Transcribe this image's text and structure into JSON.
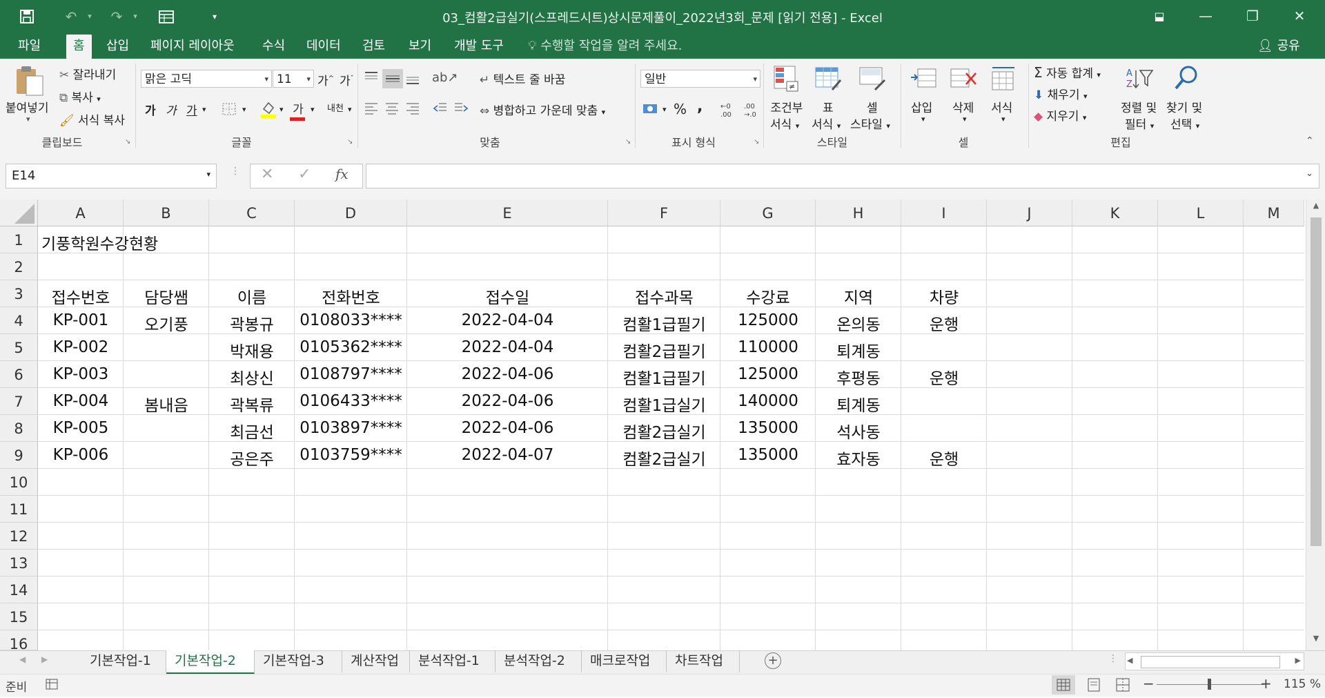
{
  "window": {
    "title": "03_컴활2급실기(스프레드시트)상시문제풀이_2022년3회_문제  [읽기 전용] - Excel",
    "minimize": "—",
    "restore": "❐",
    "close": "✕"
  },
  "menu": {
    "tabs": [
      "파일",
      "홈",
      "삽입",
      "페이지 레이아웃",
      "수식",
      "데이터",
      "검토",
      "보기",
      "개발 도구"
    ],
    "active_tab": "홈",
    "tell_me": "수행할 작업을 알려 주세요.",
    "share": "공유"
  },
  "ribbon": {
    "clipboard": {
      "paste": "붙여넣기",
      "cut": "잘라내기",
      "copy": "복사",
      "format_painter": "서식 복사",
      "label": "클립보드"
    },
    "font": {
      "name": "맑은 고딕",
      "size": "11",
      "grow": "가",
      "shrink": "가",
      "bold": "가",
      "italic": "가",
      "underline": "가",
      "font_color": "가",
      "phonetic": "내천",
      "label": "글꼴"
    },
    "alignment": {
      "wrap_text": "텍스트 줄 바꿈",
      "merge_center": "병합하고 가운데 맞춤",
      "label": "맞춤"
    },
    "number": {
      "format": "일반",
      "percent": "%",
      "comma": ",",
      "label": "표시 형식"
    },
    "styles": {
      "conditional": "조건부\n서식",
      "conditional_1": "조건부",
      "conditional_2": "서식",
      "table_1": "표",
      "table_2": "서식",
      "cell_style_1": "셀",
      "cell_style_2": "스타일",
      "label": "스타일"
    },
    "cells": {
      "insert": "삽입",
      "delete": "삭제",
      "format": "서식",
      "label": "셀"
    },
    "editing": {
      "autosum": "자동 합계",
      "fill": "채우기",
      "clear": "지우기",
      "sort_1": "정렬 및",
      "sort_2": "필터",
      "find_1": "찾기 및",
      "find_2": "선택",
      "label": "편집"
    }
  },
  "formula_bar": {
    "name_box": "E14",
    "cancel": "✕",
    "enter": "✓",
    "fx": "fx",
    "content": ""
  },
  "columns": [
    "A",
    "B",
    "C",
    "D",
    "E",
    "F",
    "G",
    "H",
    "I",
    "J",
    "K",
    "L",
    "M"
  ],
  "rows": [
    "1",
    "2",
    "3",
    "4",
    "5",
    "6",
    "7",
    "8",
    "9",
    "10",
    "11",
    "12",
    "13",
    "14",
    "15",
    "16"
  ],
  "sheet": {
    "title": "기풍학원수강현황",
    "headers": [
      "접수번호",
      "담당쌤",
      "이름",
      "전화번호",
      "접수일",
      "접수과목",
      "수강료",
      "지역",
      "차량"
    ],
    "data": [
      [
        "KP-001",
        "오기풍",
        "곽봉규",
        "0108033****",
        "2022-04-04",
        "컴활1급필기",
        "125000",
        "온의동",
        "운행"
      ],
      [
        "KP-002",
        "",
        "박재용",
        "0105362****",
        "2022-04-04",
        "컴활2급필기",
        "110000",
        "퇴계동",
        ""
      ],
      [
        "KP-003",
        "",
        "최상신",
        "0108797****",
        "2022-04-06",
        "컴활1급필기",
        "125000",
        "후평동",
        "운행"
      ],
      [
        "KP-004",
        "봄내음",
        "곽복류",
        "0106433****",
        "2022-04-06",
        "컴활1급실기",
        "140000",
        "퇴계동",
        ""
      ],
      [
        "KP-005",
        "",
        "최금선",
        "0103897****",
        "2022-04-06",
        "컴활2급실기",
        "135000",
        "석사동",
        ""
      ],
      [
        "KP-006",
        "",
        "공은주",
        "0103759****",
        "2022-04-07",
        "컴활2급실기",
        "135000",
        "효자동",
        "운행"
      ]
    ]
  },
  "sheet_tabs": [
    "기본작업-1",
    "기본작업-2",
    "기본작업-3",
    "계산작업",
    "분석작업-1",
    "분석작업-2",
    "매크로작업",
    "차트작업"
  ],
  "active_sheet": "기본작업-2",
  "status": {
    "ready": "준비",
    "zoom": "115 %"
  },
  "colors": {
    "brand": "#217346",
    "grid": "#dadada",
    "header_bg": "#efefef"
  }
}
